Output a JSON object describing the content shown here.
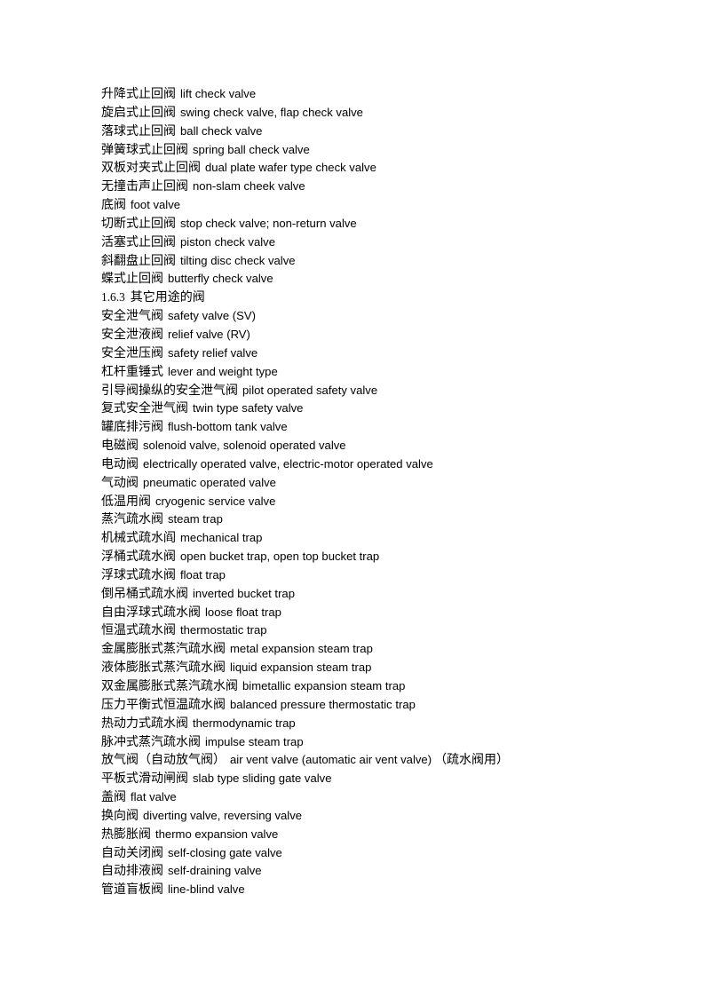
{
  "document": {
    "language": "zh-CN",
    "background_color": "#ffffff",
    "text_color": "#000000"
  },
  "section_heading": {
    "number": "1.6.3",
    "title": "其它用途的阀"
  },
  "entries": [
    {
      "term": "升降式止回阀",
      "gloss": "lift check valve"
    },
    {
      "term": "旋启式止回阀",
      "gloss": "swing check valve, flap check valve"
    },
    {
      "term": "落球式止回阀",
      "gloss": "ball check valve"
    },
    {
      "term": "弹簧球式止回阀",
      "gloss": "spring ball check valve"
    },
    {
      "term": "双板对夹式止回阀",
      "gloss": "dual plate wafer type check valve"
    },
    {
      "term": "无撞击声止回阀",
      "gloss": "non-slam cheek valve"
    },
    {
      "term": "底阀",
      "gloss": "foot valve"
    },
    {
      "term": "切断式止回阀",
      "gloss": "stop check valve; non-return valve"
    },
    {
      "term": "活塞式止回阀",
      "gloss": "piston check valve"
    },
    {
      "term": "斜翻盘止回阀",
      "gloss": "tilting disc check valve"
    },
    {
      "term": "蝶式止回阀",
      "gloss": "butterfly check valve"
    },
    {
      "heading": true,
      "number": "1.6.3",
      "title": "其它用途的阀"
    },
    {
      "term": "安全泄气阀",
      "gloss": "safety valve (SV)"
    },
    {
      "term": "安全泄液阀",
      "gloss": "relief valve (RV)"
    },
    {
      "term": "安全泄压阀",
      "gloss": "safety relief valve"
    },
    {
      "term": "杠杆重锤式",
      "gloss": "lever and weight type"
    },
    {
      "term": "引导阀操纵的安全泄气阀",
      "gloss": "pilot operated safety valve"
    },
    {
      "term": "复式安全泄气阀",
      "gloss": "twin type safety valve"
    },
    {
      "term": "罐底排污阀",
      "gloss": "flush-bottom  tank valve"
    },
    {
      "term": "电磁阀",
      "gloss": "solenoid  valve, solenoid  operated valve"
    },
    {
      "term": "电动阀",
      "gloss": "electrically operated valve, electric-motor operated valve"
    },
    {
      "term": "气动阀",
      "gloss": "pneumatic operated valve"
    },
    {
      "term": "低温用阀",
      "gloss": "cryogenic service valve"
    },
    {
      "term": "蒸汽疏水阀",
      "gloss": "steam trap"
    },
    {
      "term": "机械式疏水阎",
      "gloss": "mechanical trap"
    },
    {
      "term": "浮桶式疏水阀",
      "gloss": "open bucket trap, open top bucket trap"
    },
    {
      "term": "浮球式疏水阀",
      "gloss": "float trap"
    },
    {
      "term": "倒吊桶式疏水阀",
      "gloss": "inverted bucket trap"
    },
    {
      "term": "自由浮球式疏水阀",
      "gloss": "loose float trap"
    },
    {
      "term": "恒温式疏水阀",
      "gloss": "thermostatic trap"
    },
    {
      "term": "金属膨胀式蒸汽疏水阀",
      "gloss": "metal expansion steam trap"
    },
    {
      "term": "液体膨胀式蒸汽疏水阀",
      "gloss": "liquid expansion steam trap"
    },
    {
      "term": "双金属膨胀式蒸汽疏水阀",
      "gloss": "bimetallic expansion steam trap"
    },
    {
      "term": "压力平衡式恒温疏水阀",
      "gloss": "balanced pressure thermostatic trap"
    },
    {
      "term": "热动力式疏水阀",
      "gloss": "thermodynamic trap"
    },
    {
      "term": "脉冲式蒸汽疏水阀",
      "gloss": "impulse steam trap"
    },
    {
      "term": "放气阀（自动放气阀）",
      "gloss": "air vent valve (automatic air vent valve)",
      "note": "（疏水阀用）"
    },
    {
      "term": "平板式滑动闸阀",
      "gloss": "slab type sliding gate valve"
    },
    {
      "term": "盖阀",
      "gloss": "flat valve"
    },
    {
      "term": "换向阀",
      "gloss": "diverting valve, reversing valve"
    },
    {
      "term": "热膨胀阀",
      "gloss": "thermo expansion valve"
    },
    {
      "term": "自动关闭阀",
      "gloss": "self-closing gate valve"
    },
    {
      "term": "自动排液阀",
      "gloss": "self-draining valve"
    },
    {
      "term": "管道盲板阀",
      "gloss": "line-blind  valve"
    }
  ]
}
